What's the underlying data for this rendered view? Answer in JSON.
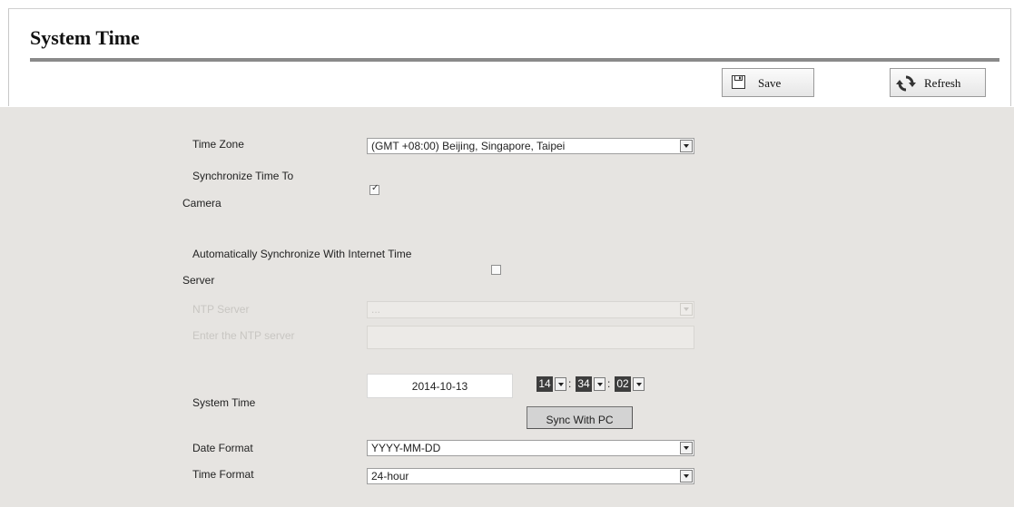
{
  "page": {
    "title": "System Time"
  },
  "toolbar": {
    "save_label": "Save",
    "refresh_label": "Refresh"
  },
  "form": {
    "time_zone": {
      "label": "Time Zone",
      "value": "(GMT +08:00) Beijing, Singapore, Taipei"
    },
    "sync_camera": {
      "label_line1": "Synchronize Time To",
      "label_line2": "Camera",
      "checked": true
    },
    "auto_sync": {
      "label_line1": "Automatically Synchronize With Internet Time",
      "label_line2": "Server",
      "checked": false
    },
    "ntp_server": {
      "label": "NTP Server",
      "value": "..."
    },
    "enter_ntp": {
      "label": "Enter the NTP server",
      "value": ""
    },
    "system_time": {
      "label": "System Time",
      "date": "2014-10-13",
      "hour": "14",
      "minute": "34",
      "second": "02",
      "separator": ":",
      "sync_button": "Sync With PC"
    },
    "date_format": {
      "label": "Date Format",
      "value": "YYYY-MM-DD"
    },
    "time_format": {
      "label": "Time Format",
      "value": "24-hour"
    }
  },
  "icons": {
    "save": "floppy-disk-icon",
    "refresh": "refresh-arrows-icon"
  }
}
